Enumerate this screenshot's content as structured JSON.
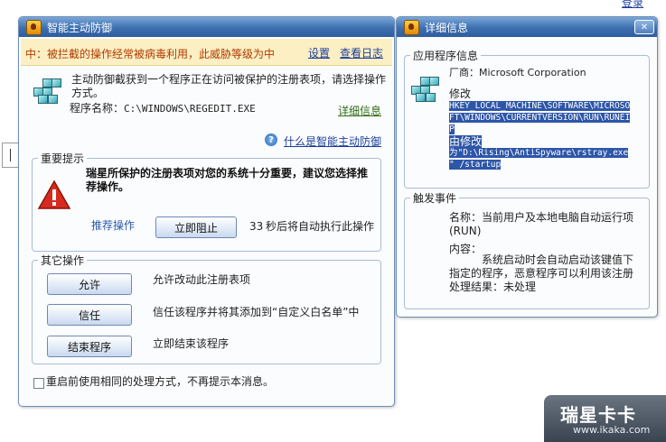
{
  "page": {
    "top_link": "登录"
  },
  "main_window": {
    "title": "智能主动防御",
    "warning": "中：被拦截的操作经常被病毒利用，此威胁等级为中",
    "settings_link": "设置",
    "log_link": "查看日志",
    "intercept_message": "主动防御截获到一个程序正在访问被保护的注册表项，请选择操作方式。",
    "program_label": "程序名称：",
    "program_path": "C:\\WINDOWS\\REGEDIT.EXE",
    "details_link": "详细信息",
    "help_link": "什么是智能主动防御",
    "important_legend": "重要提示",
    "important_text": "瑞星所保护的注册表项对您的系统十分重要，建议您选择推荐操作。",
    "recommend_label": "推荐操作",
    "block_button": "立即阻止",
    "countdown_number": "33",
    "countdown_text": "秒后将自动执行此操作",
    "other_legend": "其它操作",
    "actions": [
      {
        "button": "允许",
        "description": "允许改动此注册表项"
      },
      {
        "button": "信任",
        "description": "信任该程序并将其添加到“自定义白名单”中"
      },
      {
        "button": "结束程序",
        "description": "立即结束该程序"
      }
    ],
    "remember_checkbox": "重启前使用相同的处理方式，不再提示本消息。"
  },
  "detail_window": {
    "title": "详细信息",
    "app_legend": "应用程序信息",
    "vendor": "厂商：Microsoft Corporation",
    "modify_label": "修改",
    "modify_path_lines": [
      "HKEY_LOCAL_MACHINE\\SOFTWARE\\MICROSO",
      "FT\\WINDOWS\\CURRENTVERSION\\RUN\\RUNEI",
      "P"
    ],
    "modified_by_label": "由修改",
    "modified_to_lines": [
      "为\"D:\\Rising\\AntiSpyware\\rstray.exe",
      "\" /startup"
    ],
    "trigger_legend": "触发事件",
    "event_name": "名称：当前用户及本地电脑自动运行项(RUN)",
    "content_label": "内容：",
    "content_text": "系统启动时会自动启动该键值下指定的程序，恶意程序可以利用该注册",
    "result": "处理结果：未处理"
  },
  "watermark": {
    "brand": "瑞星卡卡",
    "url": "www.ikaka.com"
  }
}
